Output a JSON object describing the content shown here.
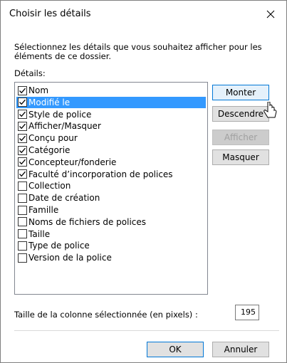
{
  "dialog": {
    "title": "Choisir les détails",
    "instruction": "Sélectionnez les détails que vous souhaitez afficher pour les éléments de ce dossier.",
    "details_label": "Détails:"
  },
  "list": {
    "items": [
      {
        "label": "Nom",
        "checked": true,
        "selected": false
      },
      {
        "label": "Modifié le",
        "checked": true,
        "selected": true
      },
      {
        "label": "Style de police",
        "checked": true,
        "selected": false
      },
      {
        "label": "Afficher/Masquer",
        "checked": true,
        "selected": false
      },
      {
        "label": "Conçu pour",
        "checked": true,
        "selected": false
      },
      {
        "label": "Catégorie",
        "checked": true,
        "selected": false
      },
      {
        "label": "Concepteur/fonderie",
        "checked": true,
        "selected": false
      },
      {
        "label": "Faculté d’incorporation de polices",
        "checked": true,
        "selected": false
      },
      {
        "label": "Collection",
        "checked": false,
        "selected": false
      },
      {
        "label": "Date de création",
        "checked": false,
        "selected": false
      },
      {
        "label": "Famille",
        "checked": false,
        "selected": false
      },
      {
        "label": "Noms de fichiers de polices",
        "checked": false,
        "selected": false
      },
      {
        "label": "Taille",
        "checked": false,
        "selected": false
      },
      {
        "label": "Type de police",
        "checked": false,
        "selected": false
      },
      {
        "label": "Version de la police",
        "checked": false,
        "selected": false
      }
    ]
  },
  "buttons": {
    "move_up": "Monter",
    "move_down": "Descendre",
    "show": "Afficher",
    "hide": "Masquer",
    "ok": "OK",
    "cancel": "Annuler"
  },
  "column_width": {
    "label": "Taille de la colonne sélectionnée (en pixels) :",
    "value": "195"
  },
  "colors": {
    "selection": "#3399ff",
    "accent": "#0078d7"
  }
}
